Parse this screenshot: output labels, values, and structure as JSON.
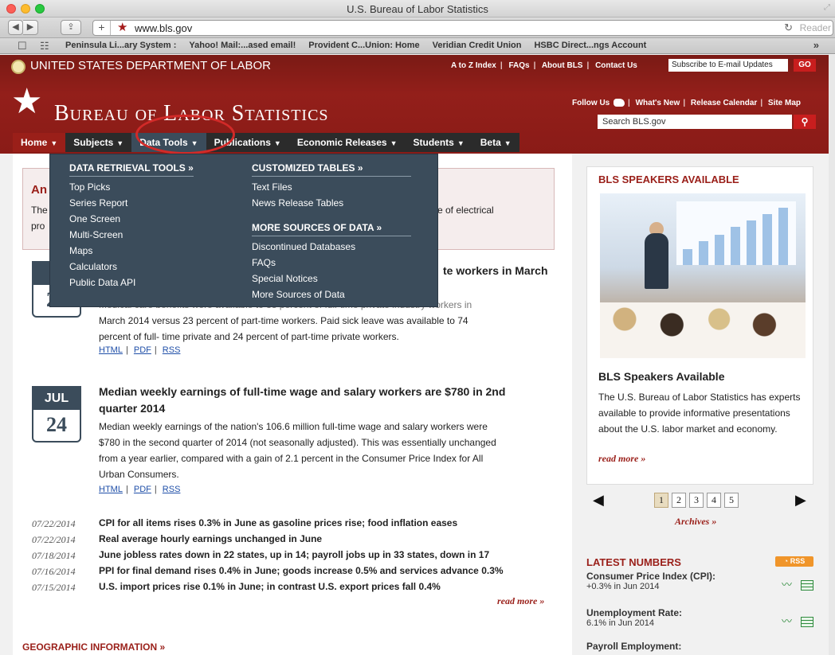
{
  "browser": {
    "window_title": "U.S. Bureau of Labor Statistics",
    "url": "www.bls.gov",
    "reader_label": "Reader",
    "bookmarks": [
      "Peninsula Li...ary System :",
      "Yahoo! Mail:...ased email!",
      "Provident C...Union: Home",
      "Veridian Credit Union",
      "HSBC Direct...ngs Account"
    ]
  },
  "header": {
    "dol_name": "UNITED STATES DEPARTMENT OF LABOR",
    "top_links": [
      "A to Z Index",
      "FAQs",
      "About BLS",
      "Contact Us"
    ],
    "subscribe_placeholder": "Subscribe to E-mail Updates",
    "go_label": "GO",
    "bls_name": "Bureau of Labor Statistics",
    "follow_us": "Follow Us",
    "follow_links": [
      "What's New",
      "Release Calendar",
      "Site Map"
    ],
    "search_placeholder": "Search BLS.gov"
  },
  "nav": {
    "items": [
      "Home",
      "Subjects",
      "Data Tools",
      "Publications",
      "Economic Releases",
      "Students",
      "Beta"
    ]
  },
  "dropdown": {
    "col1_head": "DATA RETRIEVAL TOOLS »",
    "col1_items": [
      "Top Picks",
      "Series Report",
      "One Screen",
      "Multi-Screen",
      "Maps",
      "Calculators",
      "Public Data API"
    ],
    "col2_head": "CUSTOMIZED TABLES »",
    "col2_items": [
      "Text Files",
      "News Release Tables"
    ],
    "col3_head": "MORE SOURCES OF DATA »",
    "col3_items": [
      "Discontinued Databases",
      "FAQs",
      "Special Notices",
      "More Sources of Data"
    ]
  },
  "announcement": {
    "title_visible": "An",
    "line1_left": "The",
    "line1_right": "se of electrical",
    "line2_left": "pro"
  },
  "release1": {
    "month": "J",
    "day": "25",
    "title_visible": "te workers in March",
    "text_line1": "Medical care benefits were available to 88 percent of full-time private industry workers in",
    "text_line2": "March 2014 versus 23 percent of part-time workers. Paid sick leave was available to 74",
    "text_line3": "percent of full- time private and 24 percent of part-time private workers.",
    "links": [
      "HTML",
      "PDF",
      "RSS"
    ]
  },
  "release2": {
    "month": "JUL",
    "day": "24",
    "title_line1": "Median weekly earnings of full-time wage and salary workers are $780 in 2nd",
    "title_line2": "quarter 2014",
    "text_line1": "Median weekly earnings of the nation's 106.6 million full-time wage and salary workers were",
    "text_line2": "$780 in the second quarter of 2014 (not seasonally adjusted). This was essentially unchanged",
    "text_line3": "from a year earlier, compared with a gain of 2.1 percent in the Consumer Price Index for All",
    "text_line4": "Urban Consumers.",
    "links": [
      "HTML",
      "PDF",
      "RSS"
    ]
  },
  "news": [
    {
      "date": "07/22/2014",
      "text": "CPI for all items rises 0.3% in June as gasoline prices rise; food inflation eases"
    },
    {
      "date": "07/22/2014",
      "text": "Real average hourly earnings unchanged in June"
    },
    {
      "date": "07/18/2014",
      "text": "June jobless rates down in 22 states, up in 14; payroll jobs up in 33 states, down in 17"
    },
    {
      "date": "07/16/2014",
      "text": "PPI for final demand rises 0.4% in June; goods increase 0.5% and services advance 0.3%"
    },
    {
      "date": "07/15/2014",
      "text": "U.S. import prices rise 0.1% in June; in contrast U.S. export prices fall 0.4%"
    }
  ],
  "main_read_more": "read more »",
  "geo_title": "GEOGRAPHIC INFORMATION »",
  "sidebar": {
    "title": "BLS SPEAKERS AVAILABLE",
    "heading": "BLS Speakers Available",
    "text": "The U.S. Bureau of Labor Statistics has experts available to provide informative presentations about the U.S. labor market and economy.",
    "read_more": "read more »",
    "pages": [
      "1",
      "2",
      "3",
      "4",
      "5"
    ],
    "archives": "Archives »"
  },
  "latest": {
    "title": "LATEST NUMBERS",
    "rss": "RSS",
    "items": [
      {
        "name": "Consumer Price Index (CPI):",
        "value": "+0.3% in Jun 2014"
      },
      {
        "name": "Unemployment Rate:",
        "value": "6.1% in Jun 2014"
      },
      {
        "name": "Payroll Employment:",
        "value": ""
      }
    ]
  },
  "colors": {
    "bls_red": "#9a1f19",
    "nav_slate": "#3b4c5b",
    "annotation_circle": "#d22a28"
  }
}
